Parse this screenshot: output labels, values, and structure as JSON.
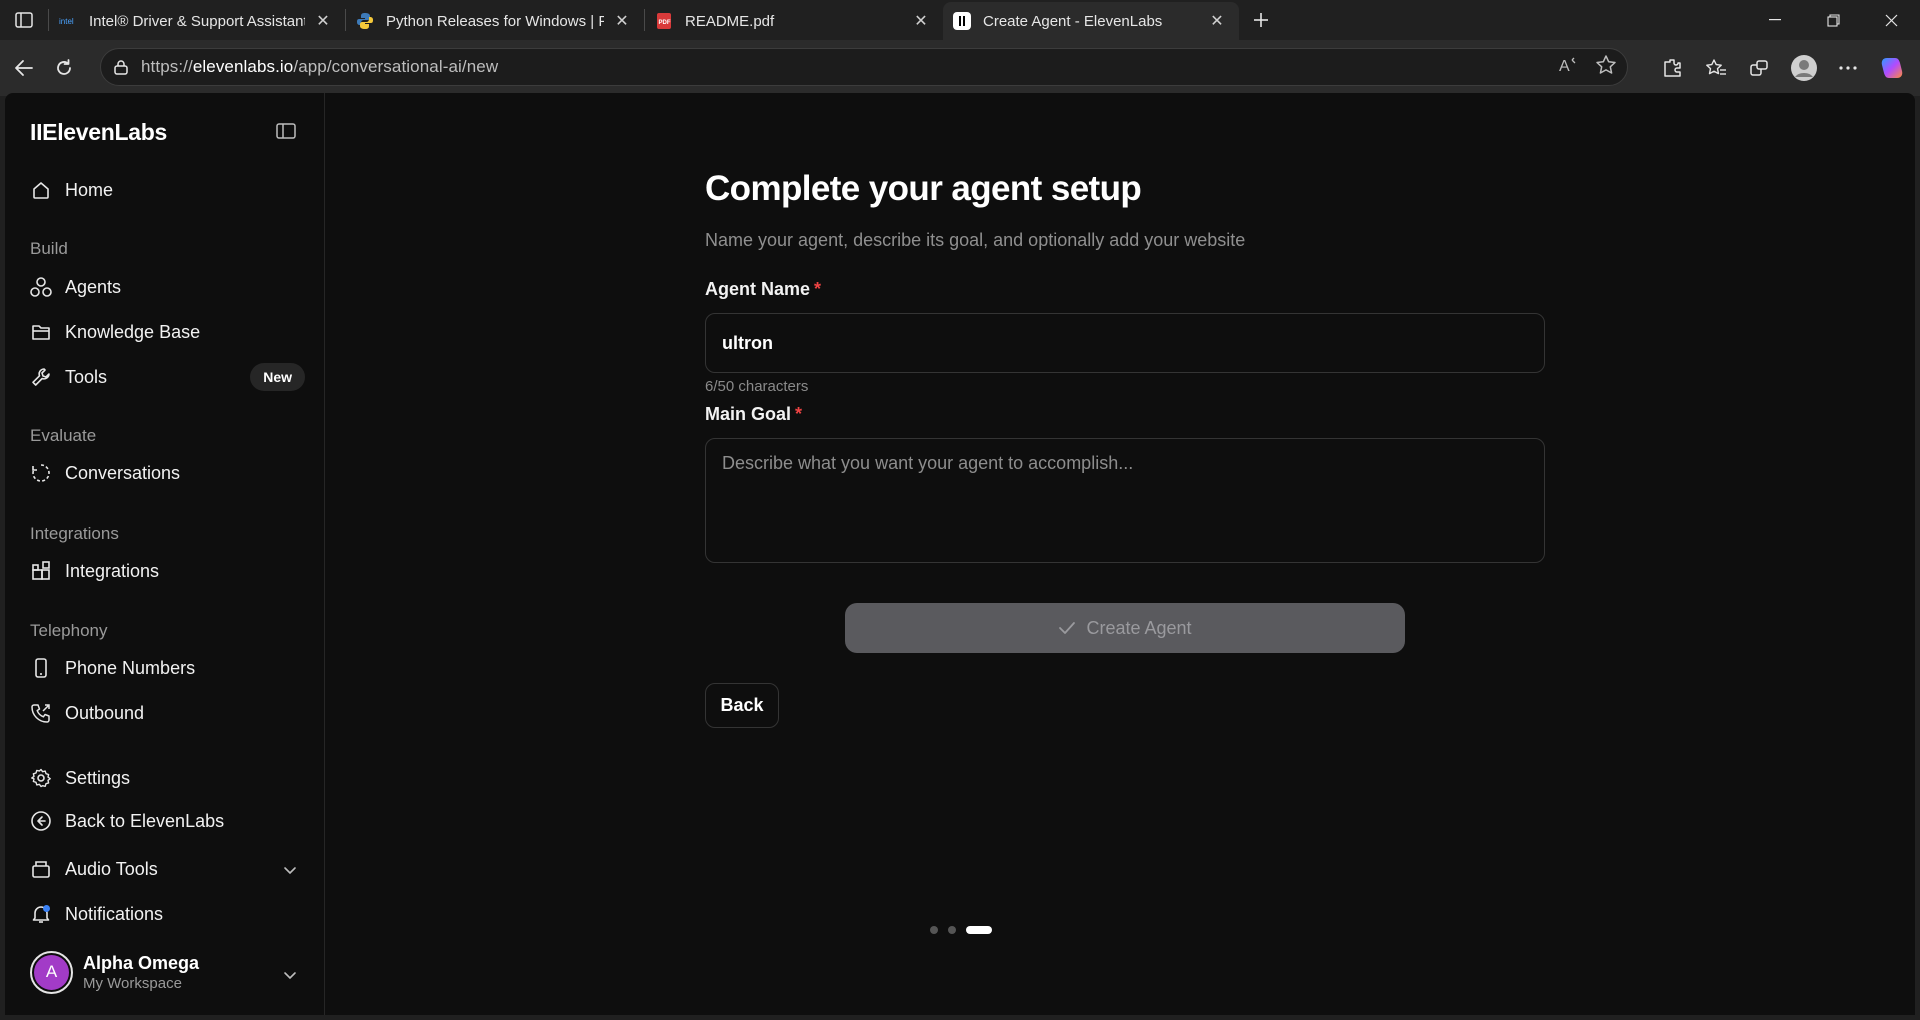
{
  "browser": {
    "tabs": [
      {
        "title": "Intel® Driver & Support Assistant",
        "favicon": "intel-icon",
        "active": false
      },
      {
        "title": "Python Releases for Windows | Py",
        "favicon": "python-icon",
        "active": false
      },
      {
        "title": "README.pdf",
        "favicon": "pdf-icon",
        "active": false
      },
      {
        "title": "Create Agent - ElevenLabs",
        "favicon": "elevenlabs-icon",
        "active": true
      }
    ],
    "url_prefix": "https://",
    "url_host": "elevenlabs.io",
    "url_path": "/app/conversational-ai/new"
  },
  "sidebar": {
    "logo": "IIElevenLabs",
    "home": "Home",
    "sections": {
      "build": "Build",
      "evaluate": "Evaluate",
      "integrations": "Integrations",
      "telephony": "Telephony"
    },
    "items": {
      "agents": "Agents",
      "knowledge_base": "Knowledge Base",
      "tools": "Tools",
      "tools_badge": "New",
      "conversations": "Conversations",
      "integrations": "Integrations",
      "phone_numbers": "Phone Numbers",
      "outbound": "Outbound",
      "settings": "Settings",
      "back": "Back to ElevenLabs",
      "audio_tools": "Audio Tools",
      "notifications": "Notifications"
    },
    "user": {
      "initial": "A",
      "name": "Alpha Omega",
      "workspace": "My Workspace"
    }
  },
  "main": {
    "title": "Complete your agent setup",
    "subtitle": "Name your agent, describe its goal, and optionally add your website",
    "agent_name_label": "Agent Name",
    "required_mark": "*",
    "agent_name_value": "ultron",
    "char_counter": "6/50 characters",
    "main_goal_label": "Main Goal",
    "main_goal_placeholder": "Describe what you want your agent to accomplish...",
    "create_button": "Create Agent",
    "back_button": "Back",
    "steps_total": 3,
    "steps_current": 3
  },
  "colors": {
    "accent_required": "#ef4444",
    "avatar": "#a23bc7",
    "notification_dot": "#3b82f6",
    "disabled_button": "#5a5a5e"
  }
}
